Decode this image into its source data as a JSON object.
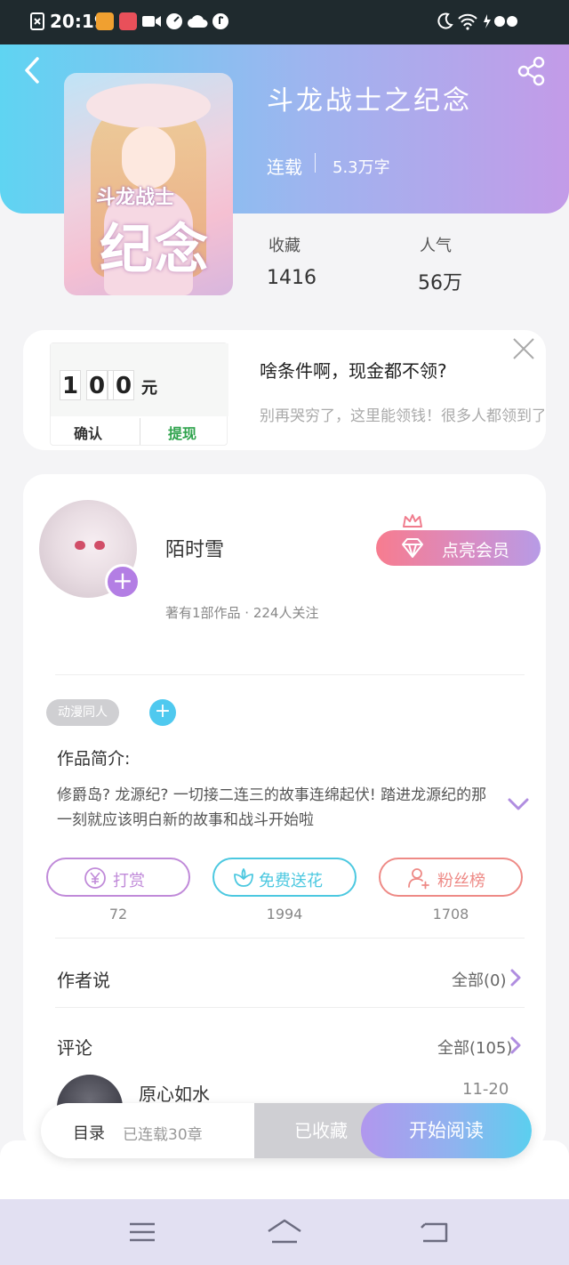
{
  "status_bar": {
    "time": "20:19"
  },
  "book": {
    "title": "斗龙战士之纪念",
    "status": "连载",
    "word_count": "5.3万字",
    "cover_title_small": "斗龙战士",
    "cover_title_big": "纪念",
    "stats": [
      {
        "label": "收藏",
        "value": "1416"
      },
      {
        "label": "人气",
        "value": "56万"
      }
    ]
  },
  "ad": {
    "digits": [
      "1",
      "0",
      "0"
    ],
    "currency": "元",
    "confirm_label": "确认",
    "withdraw_label": "提现",
    "title": "啥条件啊，现金都不领?",
    "description": "别再哭穷了，这里能领钱！很多人都领到了"
  },
  "author": {
    "name": "陌时雪",
    "meta": "著有1部作品 · 224人关注",
    "vip_button": "点亮会员"
  },
  "tags": [
    "动漫同人"
  ],
  "intro": {
    "label": "作品简介:",
    "text": "修爵岛? 龙源纪? 一切接二连三的故事连绵起伏! 踏进龙源纪的那一刻就应该明白新的故事和战斗开始啦"
  },
  "actions": [
    {
      "label": "打赏",
      "count": "72",
      "color": "#c08ad9"
    },
    {
      "label": "免费送花",
      "count": "1994",
      "color": "#4cc8e0"
    },
    {
      "label": "粉丝榜",
      "count": "1708",
      "color": "#ee8a86"
    }
  ],
  "author_says": {
    "label": "作者说",
    "link": "全部(0)"
  },
  "comments": {
    "label": "评论",
    "link": "全部(105)",
    "first": {
      "name": "原心如水",
      "date": "11-20"
    }
  },
  "bottom_bar": {
    "toc_label": "目录",
    "toc_count": "已连载30章",
    "saved_label": "已收藏",
    "read_label": "开始阅读"
  },
  "colors": {
    "accent_purple": "#b37ee4",
    "accent_blue": "#4fc9ef",
    "arrow": "#b08de0"
  }
}
